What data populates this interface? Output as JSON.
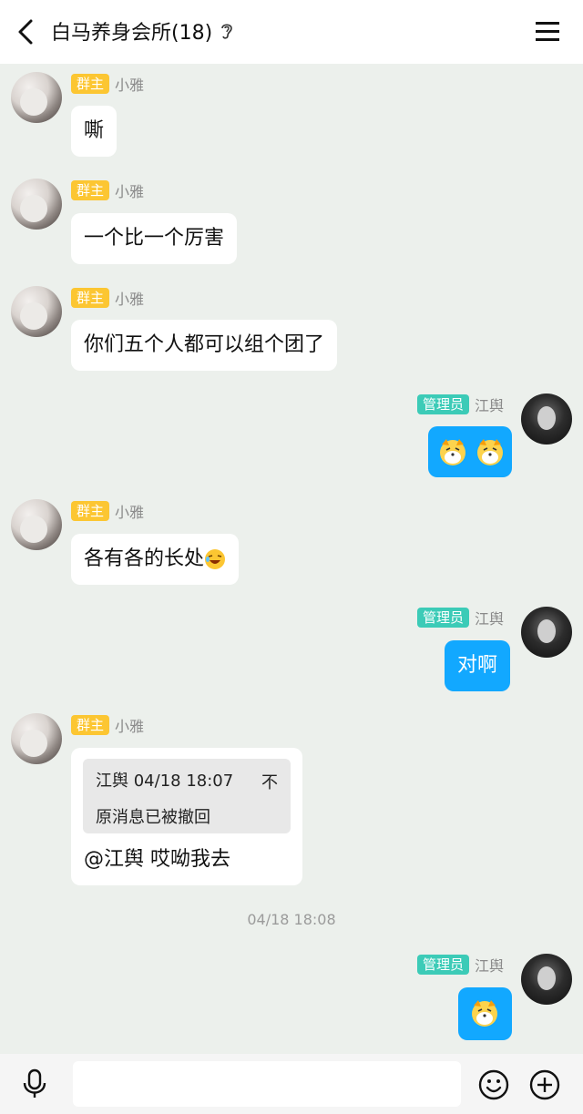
{
  "header": {
    "title": "白马养身会所(18)"
  },
  "roles": {
    "owner": "群主",
    "admin": "管理员"
  },
  "users": {
    "xiaoya": "小雅",
    "jiangyu": "江舆"
  },
  "messages": [
    {
      "sender": "小雅",
      "role": "群主",
      "text": "嘶"
    },
    {
      "sender": "小雅",
      "role": "群主",
      "text": "一个比一个厉害"
    },
    {
      "sender": "小雅",
      "role": "群主",
      "text": "你们五个人都可以组个团了"
    },
    {
      "sender": "江舆",
      "role": "管理员",
      "emoji": "dog-emoji-x2"
    },
    {
      "sender": "小雅",
      "role": "群主",
      "text": "各有各的长处",
      "emoji": "laughing-emoji"
    },
    {
      "sender": "江舆",
      "role": "管理员",
      "text": "对啊"
    },
    {
      "sender": "小雅",
      "role": "群主",
      "quote": {
        "author_time": "江舆 04/18 18:07",
        "close": "不",
        "body": "原消息已被撤回"
      },
      "text": "@江舆 哎呦我去"
    },
    {
      "sender": "江舆",
      "role": "管理员",
      "emoji": "dog-emoji"
    }
  ],
  "timestamp": "04/18 18:08",
  "colors": {
    "background": "#ecf0ec",
    "owner_badge": "#fcc632",
    "admin_badge": "#3ccbb7",
    "self_bubble": "#12a8ff"
  },
  "input": {
    "placeholder": ""
  }
}
